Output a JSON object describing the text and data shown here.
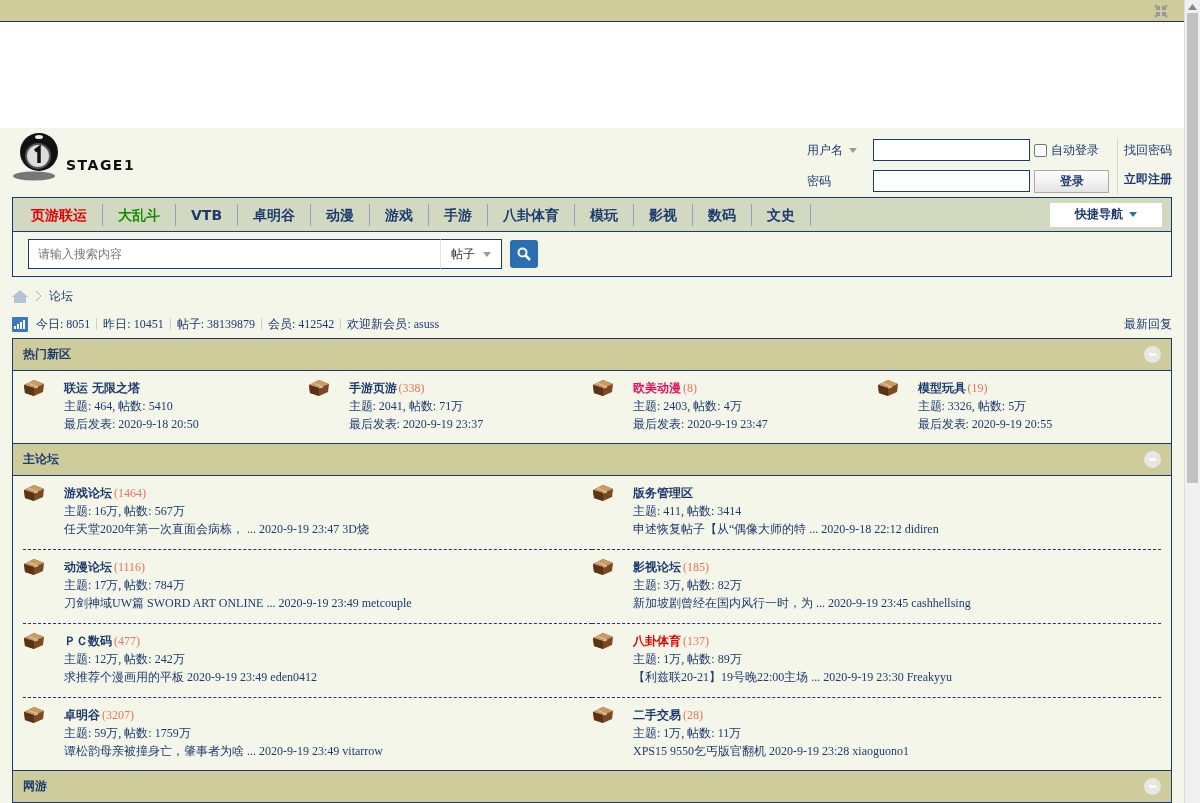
{
  "logo": {
    "text": "STAGE1"
  },
  "login": {
    "username_label": "用户名",
    "password_label": "密码",
    "auto_login": {
      "label": "自动登录",
      "checked": false
    },
    "login_button": "登录",
    "links": [
      "找回密码",
      "立即注册"
    ]
  },
  "nav": {
    "items": [
      {
        "label": "页游联运",
        "color": "#e60000"
      },
      {
        "label": "大乱斗",
        "color": "#168a00"
      },
      {
        "label": "VTB",
        "color": "#1d3a6e"
      },
      {
        "label": "卓明谷",
        "color": "#1d3a6e"
      },
      {
        "label": "动漫",
        "color": "#1d3a6e"
      },
      {
        "label": "游戏",
        "color": "#1d3a6e"
      },
      {
        "label": "手游",
        "color": "#1d3a6e"
      },
      {
        "label": "八卦体育",
        "color": "#1d3a6e"
      },
      {
        "label": "模玩",
        "color": "#1d3a6e"
      },
      {
        "label": "影视",
        "color": "#1d3a6e"
      },
      {
        "label": "数码",
        "color": "#1d3a6e"
      },
      {
        "label": "文史",
        "color": "#1d3a6e"
      }
    ],
    "quick_nav": "快捷导航"
  },
  "search": {
    "placeholder": "请输入搜索内容",
    "type": "帖子"
  },
  "breadcrumb": [
    "论坛"
  ],
  "stats": {
    "items": [
      "今日: 8051",
      "昨日: 10451",
      "帖子: 38139879",
      "会员: 412542",
      "欢迎新会员: asuss"
    ],
    "latest": "最新回复"
  },
  "sections": [
    {
      "title": "热门新区",
      "expanded": true,
      "kind": "hot",
      "forums": [
        {
          "name": "联运 无限之塔",
          "color": "#1d3a6e",
          "stats": "主题: 464, 帖数: 5410",
          "last": "最后发表: 2020-9-18 20:50"
        },
        {
          "name": "手游页游",
          "count": "(338)",
          "color": "#1d3a6e",
          "stats": "主题: 2041, 帖数: 71万",
          "last": "最后发表: 2020-9-19 23:37"
        },
        {
          "name": "欧美动漫",
          "count": "(8)",
          "color": "#e6105a",
          "stats": "主题: 2403, 帖数: 4万",
          "last": "最后发表: 2020-9-19 23:47"
        },
        {
          "name": "模型玩具",
          "count": "(19)",
          "color": "#1d3a6e",
          "stats": "主题: 3326, 帖数: 5万",
          "last": "最后发表: 2020-9-19 20:55"
        }
      ]
    },
    {
      "title": "主论坛",
      "expanded": true,
      "kind": "main",
      "forums": [
        {
          "name": "游戏论坛",
          "count": "(1464)",
          "color": "#1d3a6e",
          "stats": "主题: 16万, 帖数: 567万",
          "last": "任天堂2020年第一次直面会病栋， ... 2020-9-19 23:47 3D烧"
        },
        {
          "name": "版务管理区",
          "color": "#1d3a6e",
          "stats": "主题: 411, 帖数: 3414",
          "last": "申述恢复帖子【从“偶像大师的特 ... 2020-9-18 22:12 didiren"
        },
        {
          "name": "动漫论坛",
          "count": "(1116)",
          "color": "#1d3a6e",
          "stats": "主题: 17万, 帖数: 784万",
          "last": "刀剑神域UW篇 SWORD ART ONLINE ... 2020-9-19 23:49 metcouple"
        },
        {
          "name": "影视论坛",
          "count": "(185)",
          "color": "#1d3a6e",
          "stats": "主题: 3万, 帖数: 82万",
          "last": "新加坡剧曾经在国内风行一时，为 ... 2020-9-19 23:45 cashhellsing"
        },
        {
          "name": "ＰＣ数码",
          "count": "(477)",
          "color": "#1d3a6e",
          "stats": "主题: 12万, 帖数: 242万",
          "last": "求推荐个漫画用的平板 2020-9-19 23:49 eden0412"
        },
        {
          "name": "八卦体育",
          "count": "(137)",
          "color": "#e60000",
          "stats": "主题: 1万, 帖数: 89万",
          "last": "【利兹联20-21】19号晚22:00主场 ... 2020-9-19 23:30 Freakyyu"
        },
        {
          "name": "卓明谷",
          "count": "(3207)",
          "color": "#1d3a6e",
          "stats": "主题: 59万, 帖数: 1759万",
          "last": "谭松韵母亲被撞身亡，肇事者为啥 ... 2020-9-19 23:49 vitarrow"
        },
        {
          "name": "二手交易",
          "count": "(28)",
          "color": "#1d3a6e",
          "stats": "主题: 1万, 帖数: 11万",
          "last": "XPS15 9550乞丐版官翻机 2020-9-19 23:28 xiaoguono1"
        }
      ]
    },
    {
      "title": "网游",
      "expanded": true,
      "kind": "main"
    }
  ]
}
